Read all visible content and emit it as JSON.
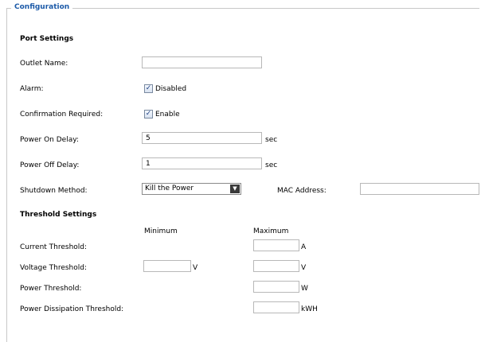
{
  "legend": "Configuration",
  "port_settings": {
    "heading": "Port Settings",
    "outlet_name": {
      "label": "Outlet Name:",
      "value": ""
    },
    "alarm": {
      "label": "Alarm:",
      "checkbox_label": "Disabled",
      "checked": true
    },
    "confirmation": {
      "label": "Confirmation Required:",
      "checkbox_label": "Enable",
      "checked": true
    },
    "power_on_delay": {
      "label": "Power On Delay:",
      "value": "5",
      "unit": "sec"
    },
    "power_off_delay": {
      "label": "Power Off Delay:",
      "value": "1",
      "unit": "sec"
    },
    "shutdown_method": {
      "label": "Shutdown Method:",
      "selected": "Kill the Power"
    },
    "mac_address": {
      "label": "MAC Address:",
      "value": ""
    }
  },
  "threshold_settings": {
    "heading": "Threshold Settings",
    "col_minimum": "Minimum",
    "col_maximum": "Maximum",
    "current": {
      "label": "Current Threshold:",
      "max_value": "",
      "unit": "A"
    },
    "voltage": {
      "label": "Voltage Threshold:",
      "min_value": "",
      "min_unit": "V",
      "max_value": "",
      "unit": "V"
    },
    "power": {
      "label": "Power Threshold:",
      "max_value": "",
      "unit": "W"
    },
    "dissipation": {
      "label": "Power Dissipation Threshold:",
      "max_value": "",
      "unit": "kWH"
    }
  },
  "icons": {
    "checkbox": "checkmark-icon",
    "dropdown": "chevron-down-icon"
  }
}
